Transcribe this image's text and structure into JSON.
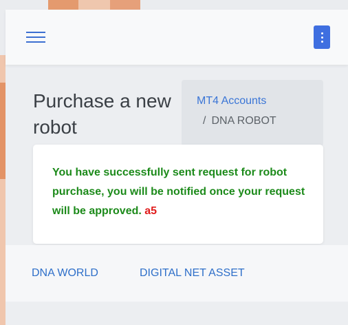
{
  "header": {
    "menu_icon": "hamburger-menu-icon",
    "more_icon": "kebab-vertical-icon",
    "accent_color": "#3f6fe0"
  },
  "page": {
    "title": "Purchase a new robot"
  },
  "breadcrumb": {
    "items": [
      {
        "label": "MT4 Accounts"
      },
      {
        "label": "DNA ROBOT"
      }
    ],
    "separator": "/"
  },
  "alert": {
    "message": "You have successfully sent request for robot purchase, you will be notified once your request will be approved.",
    "code": "a5",
    "message_color": "#1c8a1a",
    "code_color": "#e01b1b"
  },
  "footer": {
    "links": [
      {
        "label": "DNA WORLD"
      },
      {
        "label": "DIGITAL NET ASSET"
      }
    ]
  }
}
